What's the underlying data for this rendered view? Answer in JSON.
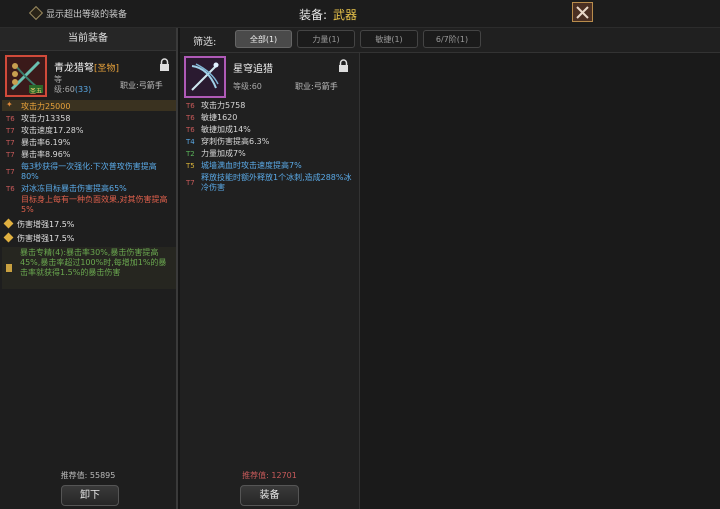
{
  "topbar": {
    "show_over_level_label": "显示超出等级的装备",
    "equip_prefix": "装备:",
    "equip_category": "武器"
  },
  "left_panel": {
    "header": "当前装备",
    "item": {
      "name": "青龙猎弩",
      "quality_tag": "[圣物]",
      "badge": "圣五",
      "level_prefix": "等",
      "level_line": "级:60",
      "level_extra": "(33)",
      "job": "职业:弓箭手"
    },
    "highlight_attack": "攻击力25000",
    "stats": [
      {
        "tier": "T6",
        "text": "攻击力13358"
      },
      {
        "tier": "T7",
        "text": "攻击速度17.28%"
      },
      {
        "tier": "T7",
        "text": "暴击率6.19%"
      },
      {
        "tier": "T7",
        "text": "暴击率8.96%"
      },
      {
        "tier": "T7",
        "text": "每3秒获得一次强化:下次普攻伤害提高80%"
      },
      {
        "tier": "T6",
        "text": "对冰冻目标暴击伤害提高65%"
      },
      {
        "tier": "",
        "text": "目标身上每有一种负面效果,对其伤害提高5%"
      }
    ],
    "dmg_boost_1": "伤害增强17.5%",
    "dmg_boost_2": "伤害增强17.5%",
    "set_bonus": "暴击专精(4):暴击率30%,暴击伤害提高45%,暴击率超过100%时,每增加1%的暴击率就获得1.5%的暴击伤害",
    "recommend_label": "推荐值:",
    "recommend_value": "55895",
    "unequip_button": "卸下"
  },
  "right_panel": {
    "filter_label": "筛选:",
    "tabs": [
      "全部(1)",
      "力量(1)",
      "敏捷(1)",
      "6/7阶(1)"
    ],
    "item": {
      "name": "星穹追猎",
      "level_line": "等级:60",
      "job": "职业:弓箭手"
    },
    "stats": [
      {
        "tier": "T6",
        "text": "攻击力5758"
      },
      {
        "tier": "T6",
        "text": "敏捷1620"
      },
      {
        "tier": "T6",
        "text": "敏捷加成14%"
      },
      {
        "tier": "T4",
        "text": "穿刺伤害提高6.3%"
      },
      {
        "tier": "T2",
        "text": "力量加成7%"
      },
      {
        "tier": "T5",
        "text": "城墙满血时攻击速度提高7%"
      },
      {
        "tier": "T7",
        "text": "释放技能时额外释放1个冰刺,造成288%冰冷伤害"
      }
    ],
    "recommend_label": "推荐值:",
    "recommend_value": "12701",
    "equip_button": "装备"
  },
  "colors": {
    "accent_gold": "#e7c24a",
    "tier_red": "#c85a5a",
    "tier_blue": "#5aa9e6",
    "item_tag": "#e7a13a"
  }
}
